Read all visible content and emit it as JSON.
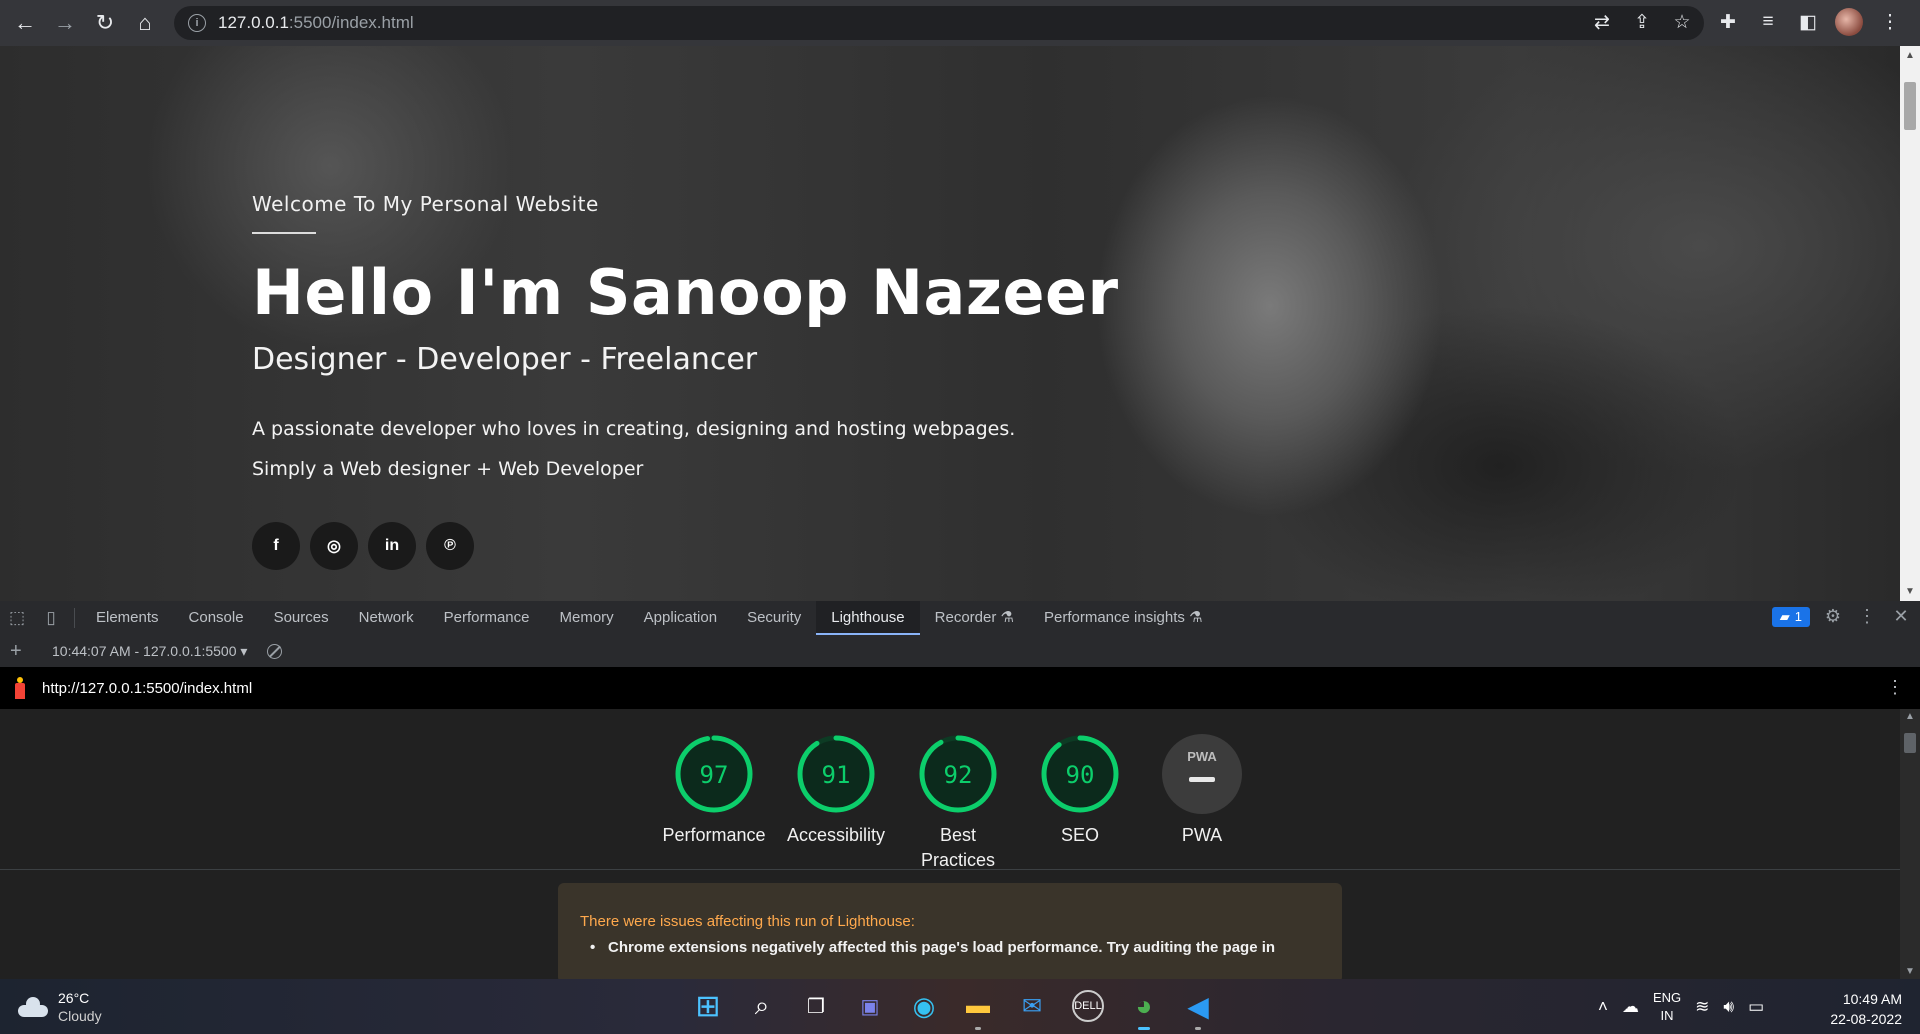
{
  "browser": {
    "url_host": "127.0.0.1",
    "url_path": ":5500/index.html"
  },
  "hero": {
    "welcome": "Welcome To My Personal Website",
    "headline": "Hello I'm Sanoop Nazeer",
    "roles": "Designer - Developer - Freelancer",
    "description_line1": "A passionate developer who loves in creating, designing and hosting webpages.",
    "description_line2": "Simply a Web designer + Web Developer",
    "socials": [
      {
        "name": "facebook",
        "glyph": "f"
      },
      {
        "name": "instagram",
        "glyph": "◎"
      },
      {
        "name": "linkedin",
        "glyph": "in"
      },
      {
        "name": "pinterest",
        "glyph": "℗"
      }
    ]
  },
  "devtools": {
    "tabs": [
      "Elements",
      "Console",
      "Sources",
      "Network",
      "Performance",
      "Memory",
      "Application",
      "Security",
      "Lighthouse",
      "Recorder",
      "Performance insights"
    ],
    "active_tab": "Lighthouse",
    "issues_count": "1",
    "report_selector": "10:44:07 AM - 127.0.0.1:5500 ▾",
    "report_url": "http://127.0.0.1:5500/index.html"
  },
  "lighthouse": {
    "scores": [
      {
        "label": "Performance",
        "score": "97",
        "value": 0.97
      },
      {
        "label": "Accessibility",
        "score": "91",
        "value": 0.91
      },
      {
        "label": "Best Practices",
        "score": "92",
        "value": 0.92
      },
      {
        "label": "SEO",
        "score": "90",
        "value": 0.9
      }
    ],
    "pwa_label": "PWA",
    "pwa_badge": "PWA",
    "pass_color": "#0cce6b",
    "warning_title": "There were issues affecting this run of Lighthouse:",
    "warning_item": "Chrome extensions negatively affected this page's load performance. Try auditing the page in"
  },
  "taskbar": {
    "temperature": "26°C",
    "weather": "Cloudy",
    "lang_line1": "ENG",
    "lang_line2": "IN",
    "time": "10:49 AM",
    "date": "22-08-2022"
  }
}
